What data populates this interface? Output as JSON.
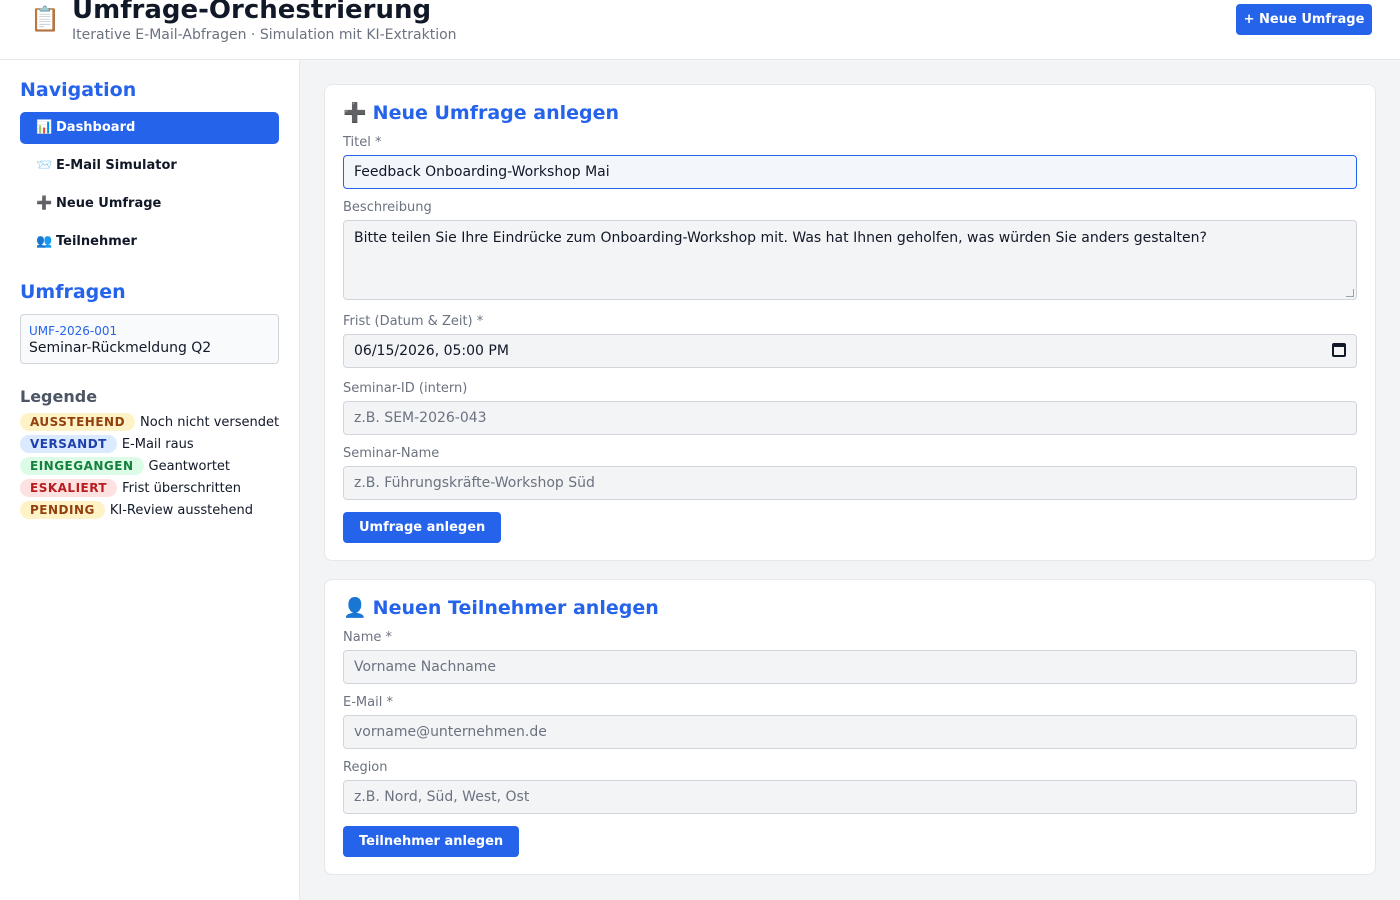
{
  "header": {
    "app_icon": "clipboard-icon",
    "title": "Umfrage-Orchestrierung",
    "subtitle": "Iterative E-Mail-Abfragen · Simulation mit KI-Extraktion",
    "new_button": "+ Neue Umfrage"
  },
  "sidebar": {
    "nav_title": "Navigation",
    "nav_items": [
      {
        "icon": "📊",
        "label": "Dashboard"
      },
      {
        "icon": "📨",
        "label": "E-Mail Simulator"
      },
      {
        "icon": "➕",
        "label": "Neue Umfrage"
      },
      {
        "icon": "👥",
        "label": "Teilnehmer"
      }
    ],
    "surveys_title": "Umfragen",
    "surveys": [
      {
        "id": "UMF-2026-001",
        "name": "Seminar-Rückmeldung Q2"
      }
    ],
    "legend_title": "Legende",
    "legend": [
      {
        "badge": "AUSSTEHEND",
        "text": "Noch nicht versendet",
        "bg": "#fef3c7",
        "fg": "#92400e"
      },
      {
        "badge": "VERSANDT",
        "text": "E-Mail raus",
        "bg": "#dbeafe",
        "fg": "#1e40af"
      },
      {
        "badge": "EINGEGANGEN",
        "text": "Geantwortet",
        "bg": "#dcfce7",
        "fg": "#15803d"
      },
      {
        "badge": "ESKALIERT",
        "text": "Frist überschritten",
        "bg": "#fee2e2",
        "fg": "#b91c1c"
      },
      {
        "badge": "PENDING",
        "text": "KI-Review ausstehend",
        "bg": "#fef3c7",
        "fg": "#92400e"
      }
    ]
  },
  "survey_form": {
    "icon": "➕",
    "title": "Neue Umfrage anlegen",
    "title_label": "Titel *",
    "title_value": "Feedback Onboarding-Workshop Mai",
    "description_label": "Beschreibung",
    "description_value": "Bitte teilen Sie Ihre Eindrücke zum Onboarding-Workshop mit. Was hat Ihnen geholfen, was würden Sie anders gestalten?",
    "deadline_label": "Frist (Datum & Zeit) *",
    "deadline_value": "06/15/2026, 05:00 PM",
    "seminar_id_label": "Seminar-ID (intern)",
    "seminar_id_placeholder": "z.B. SEM-2026-043",
    "seminar_name_label": "Seminar-Name",
    "seminar_name_placeholder": "z.B. Führungskräfte-Workshop Süd",
    "submit_label": "Umfrage anlegen"
  },
  "participant_form": {
    "icon": "👤",
    "title": "Neuen Teilnehmer anlegen",
    "name_label": "Name *",
    "name_placeholder": "Vorname Nachname",
    "email_label": "E-Mail *",
    "email_placeholder": "vorname@unternehmen.de",
    "region_label": "Region",
    "region_placeholder": "z.B. Nord, Süd, West, Ost",
    "submit_label": "Teilnehmer anlegen"
  },
  "colors": {
    "accent": "#2563eb",
    "background": "#f3f4f6",
    "card": "#ffffff"
  }
}
